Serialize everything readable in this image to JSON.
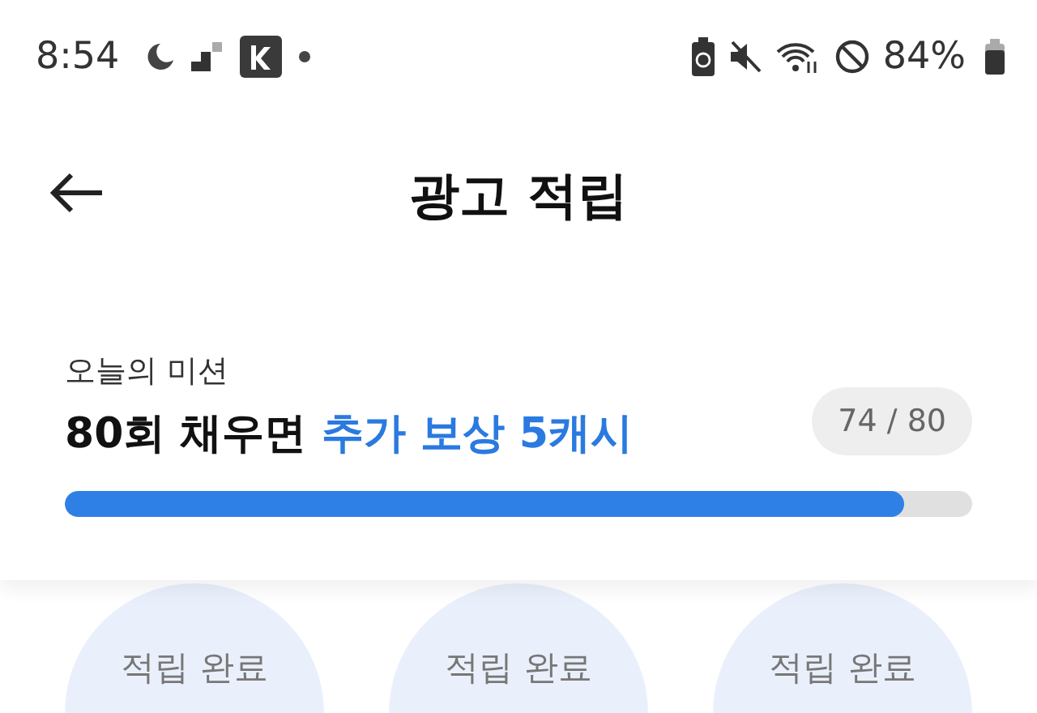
{
  "status_bar": {
    "time": "8:54",
    "battery": "84%"
  },
  "header": {
    "title": "광고 적립"
  },
  "mission": {
    "label": "오늘의 미션",
    "headline": "80회 채우면 ",
    "highlight": "추가 보상 5캐시",
    "count": "74 / 80",
    "level": 0.925
  },
  "rewards": [
    {
      "label": "적립 완료"
    },
    {
      "label": "적립 완료"
    },
    {
      "label": "적립 완료"
    }
  ]
}
